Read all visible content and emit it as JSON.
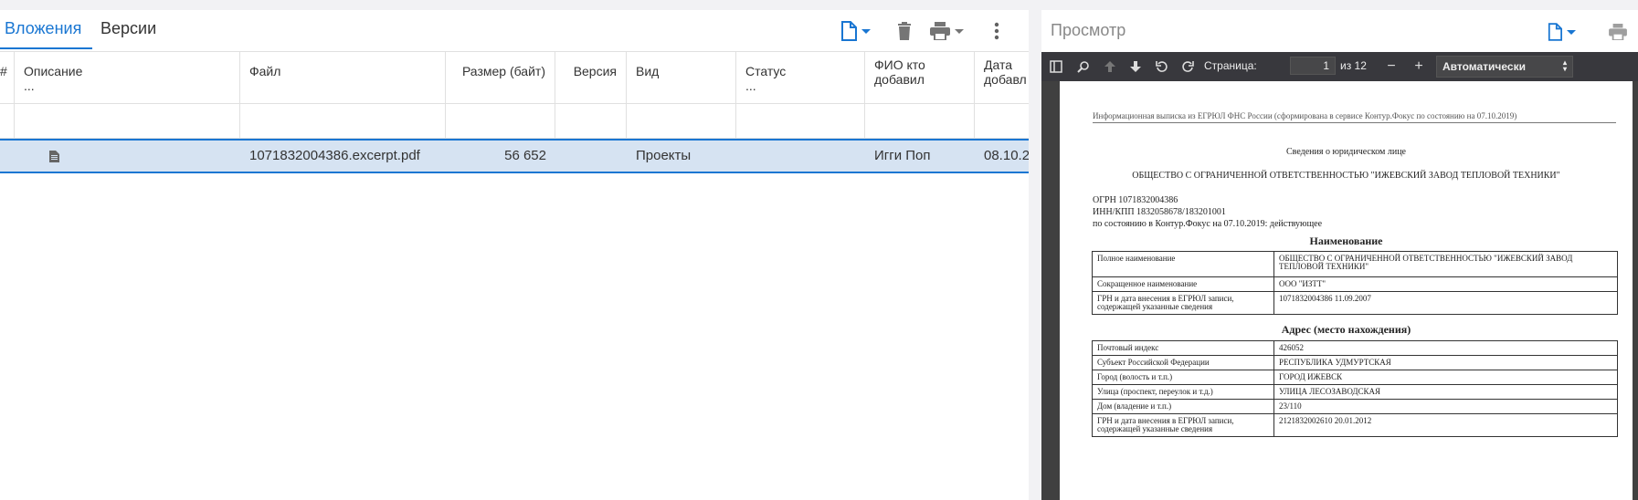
{
  "attachments": {
    "tabs": [
      {
        "label": "Вложения",
        "active": true
      },
      {
        "label": "Версии",
        "active": false
      }
    ],
    "toolbar": {
      "new_doc_icon": "file-icon",
      "delete_icon": "trash-icon",
      "print_icon": "printer-icon",
      "more_icon": "more-vert-icon"
    },
    "columns": {
      "description": "Описание",
      "description_more": "...",
      "file": "Файл",
      "size": "Размер (байт)",
      "version": "Версия",
      "kind": "Вид",
      "status": "Статус",
      "status_more": "...",
      "author_line1": "ФИО кто",
      "author_line2": "добавил",
      "date_line1": "Дата",
      "date_line2": "добавл"
    },
    "rows": [
      {
        "file": "1071832004386.excerpt.pdf",
        "size": "56 652",
        "version": "",
        "kind": "Проекты",
        "status": "",
        "author": "Игги Поп",
        "date": "08.10.2"
      }
    ]
  },
  "preview": {
    "title": "Просмотр",
    "toolbar": {
      "page_label": "Страница:",
      "page_value": "1",
      "page_total": "из 12",
      "minus": "−",
      "plus": "+",
      "zoom": "Автоматически"
    },
    "document": {
      "header": "Информационная выписка из ЕГРЮЛ ФНС России (сформирована в сервисе Контур.Фокус по состоянию на 07.10.2019)",
      "subtitle": "Сведения о юридическом лице",
      "company": "ОБЩЕСТВО С ОГРАНИЧЕННОЙ ОТВЕТСТВЕННОСТЬЮ \"ИЖЕВСКИЙ ЗАВОД ТЕПЛОВОЙ ТЕХНИКИ\"",
      "ogrn": "ОГРН 1071832004386",
      "inn": "ИНН/КПП 1832058678/183201001",
      "status": "по состоянию в Контур.Фокус на 07.10.2019: действующее",
      "section1": "Наименование",
      "table1": [
        {
          "k": "Полное наименование",
          "v": "ОБЩЕСТВО С ОГРАНИЧЕННОЙ ОТВЕТСТВЕННОСТЬЮ \"ИЖЕВСКИЙ ЗАВОД ТЕПЛОВОЙ ТЕХНИКИ\""
        },
        {
          "k": "Сокращенное наименование",
          "v": "ООО \"ИЗТТ\""
        },
        {
          "k": "ГРН и дата внесения в ЕГРЮЛ записи, содержащей указанные сведения",
          "v": "1071832004386 11.09.2007"
        }
      ],
      "section2": "Адрес (место нахождения)",
      "table2": [
        {
          "k": "Почтовый индекс",
          "v": "426052"
        },
        {
          "k": "Субъект Российской Федерации",
          "v": "РЕСПУБЛИКА УДМУРТСКАЯ"
        },
        {
          "k": "Город (волость и т.п.)",
          "v": "ГОРОД ИЖЕВСК"
        },
        {
          "k": "Улица (проспект, переулок и т.д.)",
          "v": "УЛИЦА ЛЕСОЗАВОДСКАЯ"
        },
        {
          "k": "Дом (владение и т.п.)",
          "v": "23/110"
        },
        {
          "k": "ГРН и дата внесения в ЕГРЮЛ записи, содержащей указанные сведения",
          "v": "2121832002610 20.01.2012"
        }
      ]
    }
  },
  "colors": {
    "accent": "#1976d2",
    "selected_row": "#d6e3f2",
    "pdf_toolbar": "#38383d"
  }
}
